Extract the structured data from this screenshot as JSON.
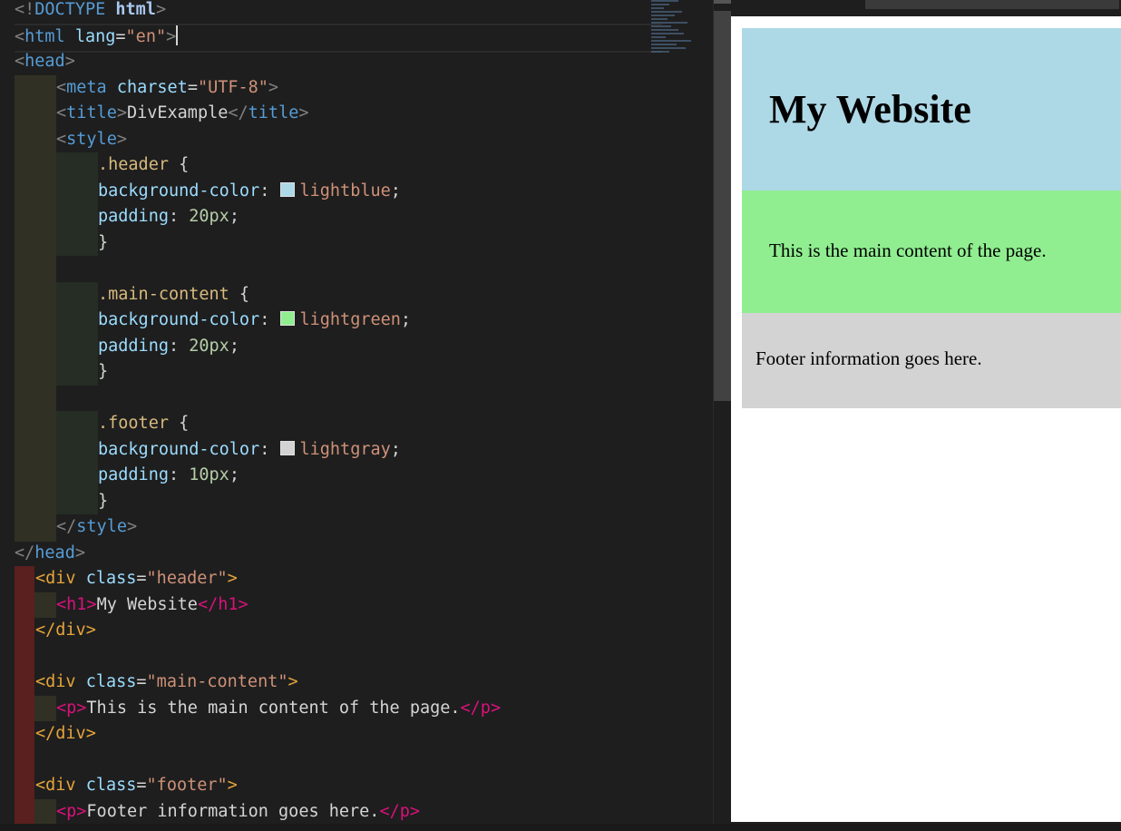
{
  "editor": {
    "l1": {
      "open": "<!",
      "kw": "DOCTYPE",
      "sp": " ",
      "name": "html",
      "close": ">"
    },
    "l2": {
      "open": "<",
      "tag": "html",
      "sp": " ",
      "attr": "lang",
      "eq": "=",
      "val": "\"en\"",
      "close": ">"
    },
    "l3": {
      "open": "<",
      "tag": "head",
      "close": ">"
    },
    "l4": {
      "open": "<",
      "tag": "meta",
      "sp": " ",
      "attr": "charset",
      "eq": "=",
      "val": "\"UTF-8\"",
      "close": ">"
    },
    "l5": {
      "open": "<",
      "tag": "title",
      "close": ">",
      "text": "DivExample",
      "open2": "</",
      "tag2": "title",
      "close2": ">"
    },
    "l6": {
      "open": "<",
      "tag": "style",
      "close": ">"
    },
    "l7": {
      "sel": ".header",
      "brace": " {"
    },
    "l8": {
      "prop": "background-color",
      "colon": ": ",
      "val": "lightblue",
      "semi": ";"
    },
    "l9": {
      "prop": "padding",
      "colon": ": ",
      "num": "20px",
      "semi": ";"
    },
    "l10": {
      "brace": "}"
    },
    "l12": {
      "sel": ".main-content",
      "brace": " {"
    },
    "l13": {
      "prop": "background-color",
      "colon": ": ",
      "val": "lightgreen",
      "semi": ";"
    },
    "l14": {
      "prop": "padding",
      "colon": ": ",
      "num": "20px",
      "semi": ";"
    },
    "l15": {
      "brace": "}"
    },
    "l17": {
      "sel": ".footer",
      "brace": " {"
    },
    "l18": {
      "prop": "background-color",
      "colon": ": ",
      "val": "lightgray",
      "semi": ";"
    },
    "l19": {
      "prop": "padding",
      "colon": ": ",
      "num": "10px",
      "semi": ";"
    },
    "l20": {
      "brace": "}"
    },
    "l21": {
      "open": "</",
      "tag": "style",
      "close": ">"
    },
    "l22": {
      "open": "</",
      "tag": "head",
      "close": ">"
    },
    "l23": {
      "open": "<div",
      "sp": " ",
      "attr": "class",
      "eq": "=",
      "val": "\"header\"",
      "close": ">"
    },
    "l24": {
      "open": "<h1>",
      "text": "My Website",
      "close": "</h1>"
    },
    "l25": {
      "tag": "</div>"
    },
    "l27": {
      "open": "<div",
      "sp": " ",
      "attr": "class",
      "eq": "=",
      "val": "\"main-content\"",
      "close": ">"
    },
    "l28": {
      "open": "<p>",
      "text": "This is the main content of the page.",
      "close": "</p>"
    },
    "l29": {
      "tag": "</div>"
    },
    "l31": {
      "open": "<div",
      "sp": " ",
      "attr": "class",
      "eq": "=",
      "val": "\"footer\"",
      "close": ">"
    },
    "l32": {
      "open": "<p>",
      "text": "Footer information goes here.",
      "close": "</p>"
    }
  },
  "swatches": {
    "lightblue": "#add8e6",
    "lightgreen": "#90ee90",
    "lightgray": "#d3d3d3"
  },
  "preview": {
    "heading": "My Website",
    "main_text": "This is the main content of the page.",
    "footer_text": "Footer information goes here."
  }
}
